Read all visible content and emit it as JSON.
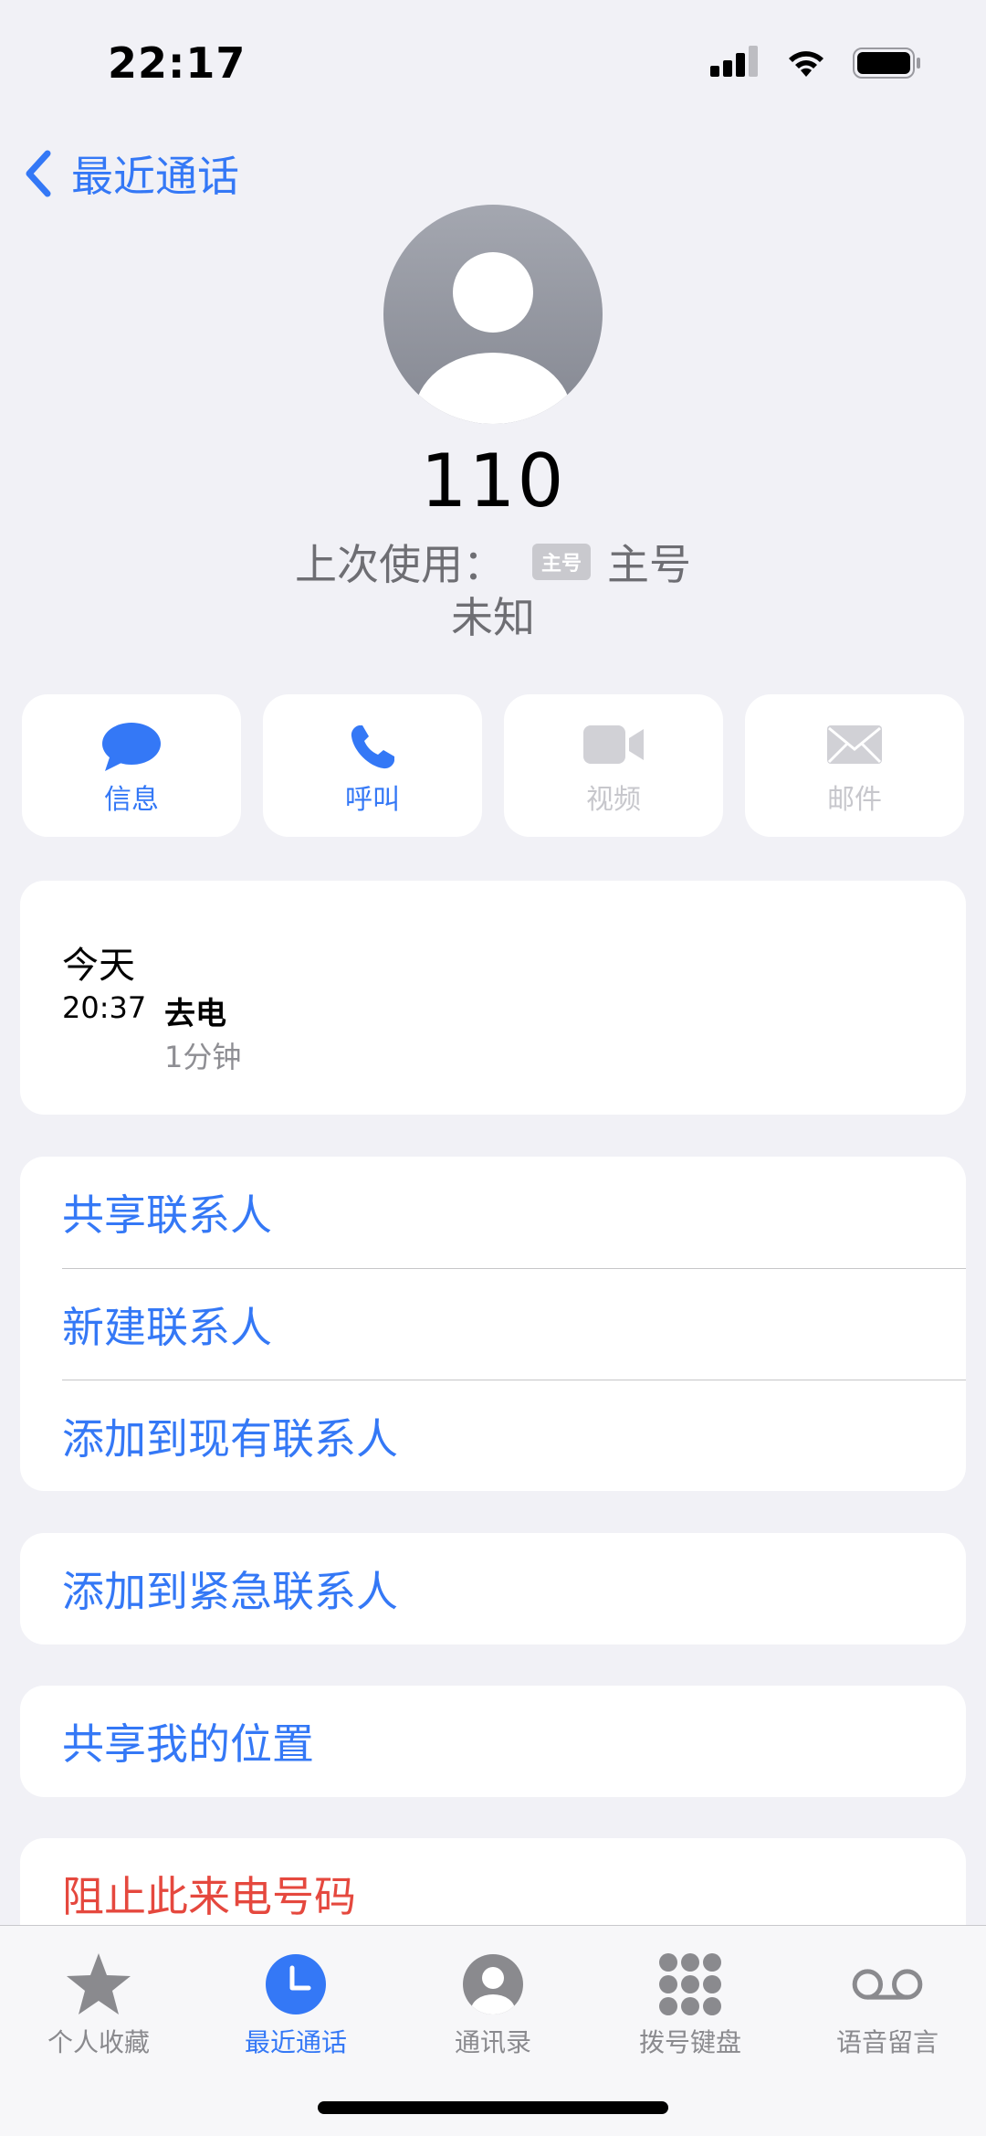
{
  "status_bar": {
    "time": "22:17"
  },
  "nav": {
    "back_label": "最近通话"
  },
  "header": {
    "number": "110",
    "last_used_label": "上次使用：",
    "sim_badge": "主号",
    "sim_name": "主号",
    "location": "未知"
  },
  "actions": [
    {
      "label": "信息",
      "icon": "message-icon",
      "enabled": true
    },
    {
      "label": "呼叫",
      "icon": "phone-icon",
      "enabled": true
    },
    {
      "label": "视频",
      "icon": "video-icon",
      "enabled": false
    },
    {
      "label": "邮件",
      "icon": "mail-icon",
      "enabled": false
    }
  ],
  "call_history": {
    "day": "今天",
    "time": "20:37",
    "type": "去电",
    "duration": "1分钟"
  },
  "menu": {
    "share_contact": "共享联系人",
    "new_contact": "新建联系人",
    "add_existing": "添加到现有联系人",
    "add_emergency": "添加到紧急联系人",
    "share_location": "共享我的位置",
    "block_number": "阻止此来电号码"
  },
  "tabs": [
    {
      "label": "个人收藏",
      "icon": "star-icon",
      "active": false
    },
    {
      "label": "最近通话",
      "icon": "clock-icon",
      "active": true
    },
    {
      "label": "通讯录",
      "icon": "contacts-icon",
      "active": false
    },
    {
      "label": "拨号键盘",
      "icon": "keypad-icon",
      "active": false
    },
    {
      "label": "语音留言",
      "icon": "voicemail-icon",
      "active": false
    }
  ],
  "colors": {
    "accent": "#3478F6",
    "destructive": "#E5483E",
    "background": "#F1F1F6",
    "disabled": "#C7C7CC"
  }
}
